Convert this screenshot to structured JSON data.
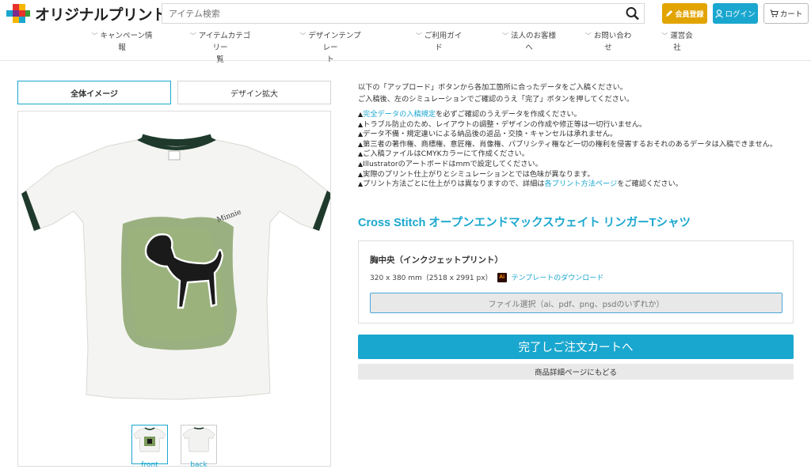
{
  "header": {
    "logo_text": "オリジナルプリント.jp",
    "search_placeholder": "アイテム検索",
    "member_label": "会員登録",
    "login_label": "ログイン",
    "cart_label": "カート"
  },
  "nav": [
    {
      "line1": "キャンペーン情",
      "line2": "報"
    },
    {
      "line1": "アイテムカテゴリー",
      "line2": "覧"
    },
    {
      "line1": "デザインテンプレー",
      "line2": "ト"
    },
    {
      "line1": "ご利用ガイ",
      "line2": "ド"
    },
    {
      "line1": "法人のお客様",
      "line2": "へ"
    },
    {
      "line1": "お問い合わ",
      "line2": "せ"
    },
    {
      "line1": "運営会",
      "line2": "社"
    }
  ],
  "tabs": {
    "overall": "全体イメージ",
    "zoom": "デザイン拡大"
  },
  "thumbs": [
    {
      "label": "front"
    },
    {
      "label": "back"
    }
  ],
  "intro": {
    "line1": "以下の「アップロード」ボタンから各加工箇所に合ったデータをご入稿ください。",
    "line2": "ご入稿後、左のシミュレーションでご確認のうえ「完了」ボタンを押してください。"
  },
  "notes": {
    "n1_link": "完全データの入稿規定",
    "n1_rest": "を必ずご確認のうえデータを作成ください。",
    "n2": "トラブル防止のため、レイアウトの調整・デザインの作成や修正等は一切行いません。",
    "n3": "データ不備・規定違いによる納品後の返品・交換・キャンセルは承れません。",
    "n4": "第三者の著作権、商標権、意匠権、肖像権、パブリシティ権など一切の権利を侵害するおそれのあるデータは入稿できません。",
    "n5": "ご入稿ファイルはCMYKカラーにて作成ください。",
    "n6": "Illustratorのアートボードはmmで設定してください。",
    "n7": "実際のプリント仕上がりとシミュレーションとでは色味が異なります。",
    "n8_a": "プリント方法ごとに仕上がりは異なりますので、詳細は",
    "n8_link": "各プリント方法ページ",
    "n8_b": "をご確認ください。"
  },
  "product": {
    "title": "Cross Stitch オープンエンドマックスウェイト リンガーTシャツ",
    "area_title": "胸中央（インクジェットプリント）",
    "size": "320 x 380 mm（2518 x 2991 px）",
    "ai_badge": "Ai",
    "template_link": "テンプレートのダウンロード",
    "file_button": "ファイル選択（ai、pdf、png、psdのいずれか）"
  },
  "actions": {
    "complete": "完了しご注文カートへ",
    "back": "商品詳細ページにもどる"
  },
  "colors": {
    "accent": "#1aa7cf",
    "member": "#e2a400",
    "shirt_trim": "#1f3a2c",
    "print_green": "#7c9a5a"
  }
}
